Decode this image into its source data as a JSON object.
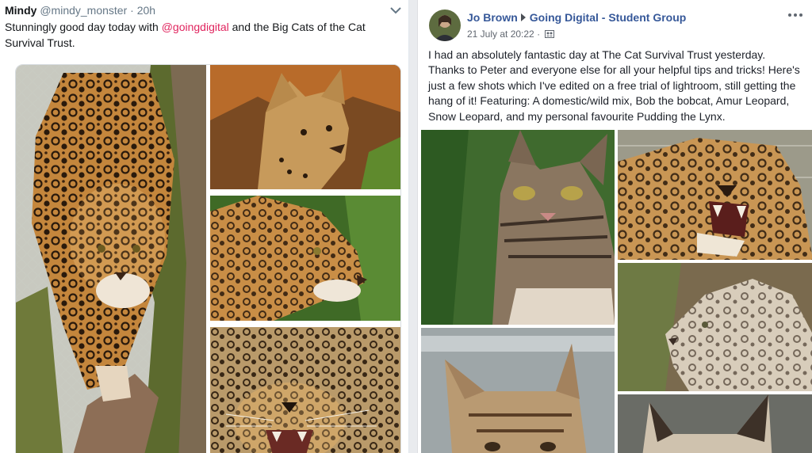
{
  "tweet": {
    "display_name": "Mindy",
    "handle": "@mindy_monster",
    "separator": "·",
    "time": "20h",
    "text_before": "Stunningly good day today with ",
    "mention": "@goingdigital",
    "text_after": " and the Big Cats of the Cat Survival Trust.",
    "menu_icon": "chevron-down-icon",
    "photos": [
      "jaguar-on-tree-photo",
      "serval-photo",
      "jaguar-profile-photo",
      "snarling-jaguar-photo"
    ]
  },
  "facebook_post": {
    "author": "Jo Brown",
    "group": "Going Digital - Student Group",
    "timestamp": "21 July at 20:22",
    "separator": "·",
    "audience_icon": "group-audience-icon",
    "more_icon": "more-options-icon",
    "text": "I had an absolutely fantastic day at The Cat Survival Trust yesterday. Thanks to Peter and everyone else for all your helpful tips and tricks! Here's just a few shots which I've edited on a free trial of lightroom, still getting the hang of it! Featuring: A domestic/wild mix, Bob the bobcat, Amur Leopard, Snow Leopard, and my personal favourite Pudding the Lynx.",
    "photos": [
      "domestic-wild-mix-photo",
      "amur-leopard-photo",
      "snow-leopard-photo",
      "bobcat-photo",
      "lynx-photo"
    ]
  },
  "colors": {
    "twitter_mention": "#e0245e",
    "facebook_link": "#365899",
    "page_bg": "#e9ebee"
  }
}
